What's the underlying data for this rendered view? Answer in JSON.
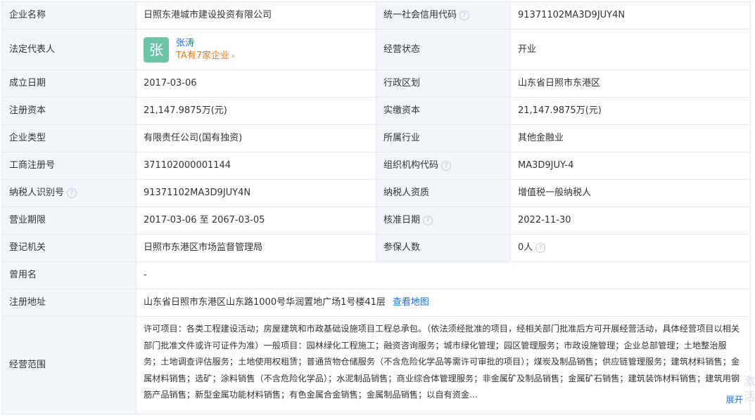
{
  "rows": [
    {
      "l1": "企业名称",
      "v1": "日照东港城市建设投资有限公司",
      "l2": "统一社会信用代码",
      "v2": "91371102MA3D9JUY4N"
    },
    {
      "l1": "法定代表人",
      "l2": "经营状态",
      "v2": "开业"
    },
    {
      "l1": "成立日期",
      "v1": "2017-03-06",
      "l2": "行政区划",
      "v2": "山东省日照市东港区"
    },
    {
      "l1": "注册资本",
      "v1": "21,147.9875万(元)",
      "l2": "实缴资本",
      "v2": "21,147.9875万(元)"
    },
    {
      "l1": "企业类型",
      "v1": "有限责任公司(国有独资)",
      "l2": "所属行业",
      "v2": "其他金融业"
    },
    {
      "l1": "工商注册号",
      "v1": "371102000001144",
      "l2": "组织机构代码",
      "v2": "MA3D9JUY-4"
    },
    {
      "l1": "纳税人识别号",
      "v1": "91371102MA3D9JUY4N",
      "l2": "纳税人资质",
      "v2": "增值税一般纳税人"
    },
    {
      "l1": "营业期限",
      "v1": "2017-03-06 至 2067-03-05",
      "l2": "核准日期",
      "v2": "2022-11-30"
    },
    {
      "l1": "登记机关",
      "v1": "日照市东港区市场监督管理局",
      "l2": "参保人数",
      "v2": "0人"
    },
    {
      "l1": "曾用名",
      "v1": "-"
    },
    {
      "l1": "注册地址",
      "v1": "山东省日照市东港区山东路1000号华润置地广场1号楼41层"
    },
    {
      "l1": "经营范围"
    }
  ],
  "legal_rep": {
    "avatar_char": "张",
    "name": "张涛",
    "companies_link": "TA有7家企业"
  },
  "address_map_link": "查看地图",
  "help_glyph": "?",
  "chevron_glyph": "›",
  "scope": {
    "text": "许可项目：各类工程建设活动；房屋建筑和市政基础设施项目工程总承包。（依法须经批准的项目，经相关部门批准后方可开展经营活动，具体经营项目以相关部门批准文件或许可证件为准）一般项目：园林绿化工程施工；融资咨询服务；城市绿化管理；园区管理服务；市政设施管理；企业总部管理；土地整治服务；土地调查评估服务；土地使用权租赁；普通货物仓储服务（不含危险化学品等需许可审批的项目）；煤炭及制品销售；供应链管理服务；建筑材料销售；金属材料销售；选矿；涂料销售（不含危险化学品）；水泥制品销售；商业综合体管理服务；非金属矿及制品销售；金属矿石销售；建筑装饰材料销售；建筑用钢筋产品销售；新型金属功能材料销售；有色金属合金销售；金属制品销售；以自有资金...",
    "expand_label": "展开"
  },
  "watermark": "激活"
}
